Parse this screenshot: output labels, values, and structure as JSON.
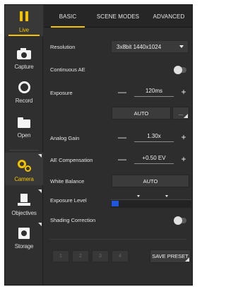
{
  "sidebar": {
    "items": [
      {
        "label": "Live",
        "icon": "pause-icon",
        "active": true
      },
      {
        "label": "Capture",
        "icon": "camera-icon"
      },
      {
        "label": "Record",
        "icon": "record-icon"
      },
      {
        "label": "Open",
        "icon": "folder-icon"
      },
      {
        "label": "Camera",
        "icon": "camera-settings-icon",
        "active": true
      },
      {
        "label": "Objectives",
        "icon": "objectives-icon"
      },
      {
        "label": "Storage",
        "icon": "storage-icon"
      }
    ]
  },
  "tabs": [
    {
      "label": "BASIC",
      "active": true
    },
    {
      "label": "SCENE MODES"
    },
    {
      "label": "ADVANCED"
    }
  ],
  "settings": {
    "resolution": {
      "label": "Resolution",
      "value": "3x8bit 1440x1024"
    },
    "continuous_ae": {
      "label": "Continuous AE",
      "on": false
    },
    "exposure": {
      "label": "Exposure",
      "value": "120ms",
      "minus": "—",
      "plus": "+"
    },
    "auto_btn": "AUTO",
    "more_btn": "...",
    "analog_gain": {
      "label": "Analog Gain",
      "value": "1.30x",
      "minus": "—",
      "plus": "+"
    },
    "ae_compensation": {
      "label": "AE Compensation",
      "value": "+0.50 EV",
      "minus": "—",
      "plus": "+"
    },
    "white_balance": {
      "label": "White Balance",
      "button": "AUTO"
    },
    "exposure_level": {
      "label": "Exposure Level",
      "marker_color": "#1e58d8"
    },
    "shading_correction": {
      "label": "Shading Correction",
      "on": false
    }
  },
  "presets": {
    "slots": [
      "1",
      "2",
      "3",
      "4"
    ],
    "save_label": "SAVE PRESET"
  },
  "colors": {
    "accent": "#f2c200",
    "background": "#2d2d2d"
  }
}
